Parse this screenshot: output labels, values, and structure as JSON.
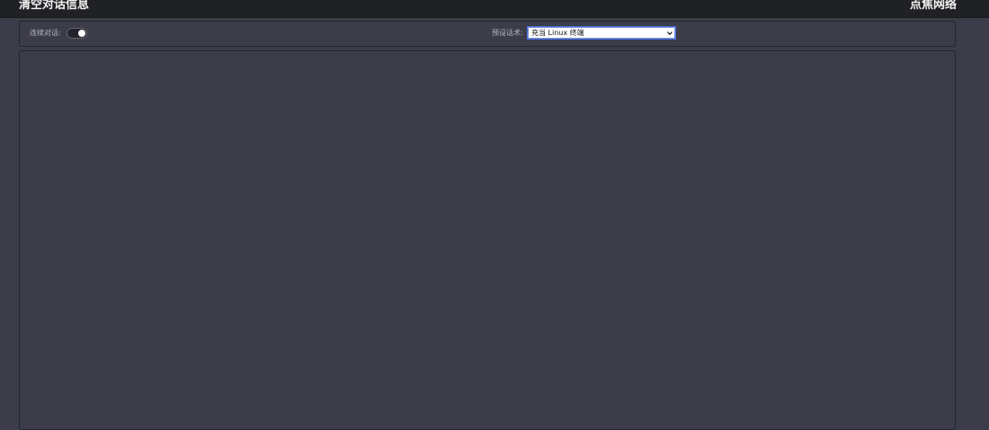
{
  "header": {
    "left_title": "清空对话信息",
    "right_title": "点焦网络"
  },
  "toolbar": {
    "continuous_label": "连续对话:",
    "continuous_enabled": true,
    "preset_label": "预设话术:",
    "preset_selected": "充当 Linux 终端"
  },
  "icons": {
    "dropdown": "chevron-down-icon"
  },
  "colors": {
    "background": "#3c3d49",
    "topbar": "#202125",
    "select_border": "#4a6fe0"
  }
}
